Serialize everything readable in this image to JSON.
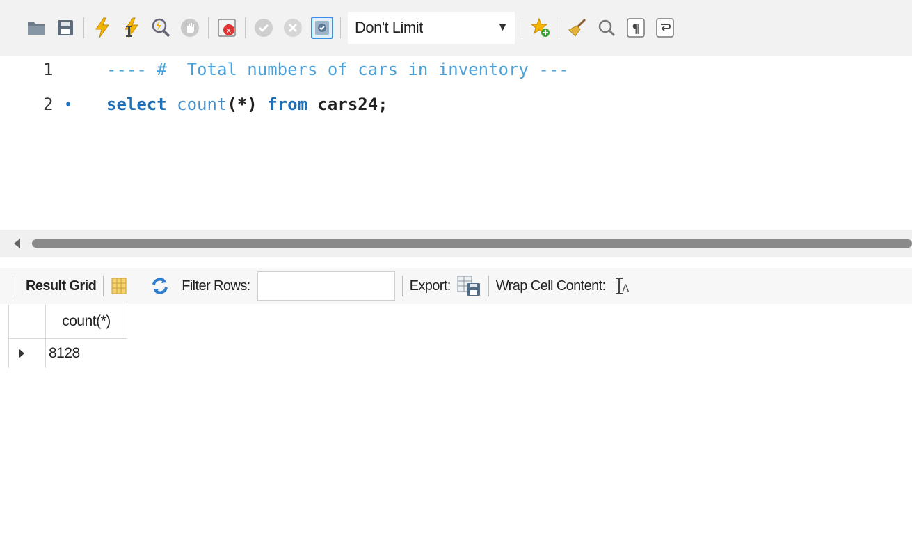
{
  "toolbar": {
    "buttons": [
      {
        "name": "open-folder",
        "icon": "folder-icon"
      },
      {
        "name": "save",
        "icon": "save-icon"
      },
      {
        "name": "execute",
        "icon": "lightning-icon"
      },
      {
        "name": "execute-current",
        "icon": "lightning-cursor-icon"
      },
      {
        "name": "explain",
        "icon": "magnifier-explain-icon"
      },
      {
        "name": "stop",
        "icon": "stop-hand-icon"
      },
      {
        "name": "toggle-error",
        "icon": "error-toggle-icon"
      },
      {
        "name": "commit",
        "icon": "check-circle-icon"
      },
      {
        "name": "rollback",
        "icon": "x-circle-icon"
      },
      {
        "name": "autocommit",
        "icon": "autocommit-icon"
      }
    ],
    "limit_select": {
      "value": "Don't Limit"
    },
    "right_buttons": [
      {
        "name": "add-snippet",
        "icon": "star-plus-icon"
      },
      {
        "name": "beautify",
        "icon": "broom-icon"
      },
      {
        "name": "find",
        "icon": "find-icon"
      },
      {
        "name": "invisible-chars",
        "icon": "pilcrow-icon"
      },
      {
        "name": "word-wrap",
        "icon": "wrap-icon"
      }
    ]
  },
  "editor": {
    "lines": [
      {
        "number": "1",
        "breakpoint": "",
        "comment": "---- #  Total numbers of cars in inventory ---"
      },
      {
        "number": "2",
        "breakpoint": "•",
        "kw1": "select",
        "fn": "count",
        "paren": "(*)",
        "kw2": "from",
        "table": "cars24;"
      }
    ]
  },
  "result_bar": {
    "result_grid": "Result Grid",
    "filter_rows": "Filter Rows:",
    "filter_value": "",
    "export": "Export:",
    "wrap_cell": "Wrap Cell Content:"
  },
  "grid": {
    "columns": [
      "count(*)"
    ],
    "rows": [
      [
        "8128"
      ]
    ]
  },
  "colors": {
    "accent": "#3a8ee6",
    "comment": "#4aa0d8",
    "keyword": "#1f6fb8"
  }
}
